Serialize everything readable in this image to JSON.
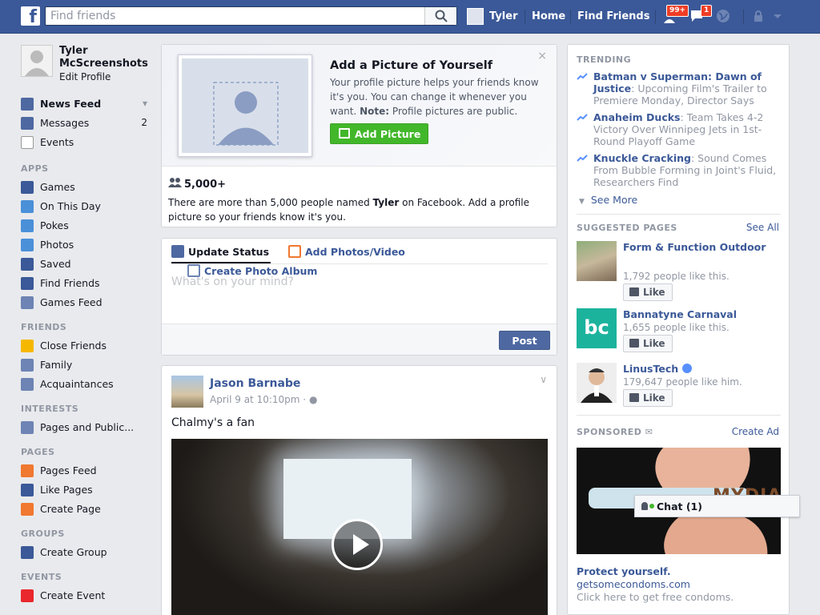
{
  "topbar": {
    "search_placeholder": "Find friends",
    "user_name": "Tyler",
    "home": "Home",
    "find_friends": "Find Friends",
    "friend_requests_badge": "99+",
    "messages_badge": "1"
  },
  "profile": {
    "name": "Tyler McScreenshots",
    "edit": "Edit Profile"
  },
  "nav": {
    "favorites": [
      {
        "label": "News Feed",
        "icon": "news-feed-icon",
        "color": "#4e69a2"
      },
      {
        "label": "Messages",
        "icon": "messages-icon",
        "color": "#4e69a2",
        "count": "2"
      },
      {
        "label": "Events",
        "icon": "calendar-icon",
        "color": "#ffffff"
      }
    ],
    "apps_header": "APPS",
    "apps": [
      {
        "label": "Games",
        "icon": "games-icon",
        "color": "#3b5998"
      },
      {
        "label": "On This Day",
        "icon": "clock-icon",
        "color": "#4a90d9"
      },
      {
        "label": "Pokes",
        "icon": "pokes-icon",
        "color": "#4a90d9"
      },
      {
        "label": "Photos",
        "icon": "photos-icon",
        "color": "#4a90d9"
      },
      {
        "label": "Saved",
        "icon": "bookmark-icon",
        "color": "#3b5998"
      },
      {
        "label": "Find Friends",
        "icon": "find-friends-icon",
        "color": "#3b5998"
      },
      {
        "label": "Games Feed",
        "icon": "gamepad-icon",
        "color": "#6d84b4"
      }
    ],
    "friends_header": "FRIENDS",
    "friends": [
      {
        "label": "Close Friends",
        "icon": "star-icon",
        "color": "#f5b800"
      },
      {
        "label": "Family",
        "icon": "family-icon",
        "color": "#6d84b4"
      },
      {
        "label": "Acquaintances",
        "icon": "acquaintances-icon",
        "color": "#6d84b4"
      }
    ],
    "interests_header": "INTERESTS",
    "interests": [
      {
        "label": "Pages and Public...",
        "icon": "list-icon",
        "color": "#6d84b4"
      }
    ],
    "pages_header": "PAGES",
    "pages": [
      {
        "label": "Pages Feed",
        "icon": "flag-icon",
        "color": "#f07830"
      },
      {
        "label": "Like Pages",
        "icon": "thumbs-up-icon",
        "color": "#3b5998"
      },
      {
        "label": "Create Page",
        "icon": "plus-icon",
        "color": "#f07830"
      }
    ],
    "groups_header": "GROUPS",
    "groups": [
      {
        "label": "Create Group",
        "icon": "plus-icon",
        "color": "#3b5998"
      }
    ],
    "events_header": "EVENTS",
    "events": [
      {
        "label": "Create Event",
        "icon": "plus-icon",
        "color": "#e9272d"
      }
    ]
  },
  "add_picture": {
    "title": "Add a Picture of Yourself",
    "desc_main": "Your profile picture helps your friends know it's you. You can change it whenever you want.",
    "note_label": "Note:",
    "note_text": "Profile pictures are public.",
    "button": "Add Picture",
    "close": "×",
    "count": "5,000+",
    "name_desc_pre": "There are more than 5,000 people named",
    "name_desc_name": "Tyler",
    "name_desc_post": "on Facebook. Add a profile picture so your friends know it's you."
  },
  "composer": {
    "tab_status": "Update Status",
    "tab_photos": "Add Photos/Video",
    "tab_album": "Create Photo Album",
    "placeholder": "What's on your mind?",
    "post": "Post"
  },
  "post": {
    "author": "Jason Barnabe",
    "time": "April 9 at 10:10pm",
    "separator": "·",
    "text": "Chalmy's a fan"
  },
  "right": {
    "trending_header": "TRENDING",
    "trending": [
      {
        "title": "Batman v Superman: Dawn of Justice",
        "desc": ": Upcoming Film's Trailer to Premiere Monday, Director Says"
      },
      {
        "title": "Anaheim Ducks",
        "desc": ": Team Takes 4-2 Victory Over Winnipeg Jets in 1st-Round Playoff Game"
      },
      {
        "title": "Knuckle Cracking",
        "desc": ": Sound Comes From Bubble Forming in Joint's Fluid, Researchers Find"
      }
    ],
    "see_more": "See More",
    "suggested_header": "SUGGESTED PAGES",
    "see_all": "See All",
    "suggested": [
      {
        "name": "Form & Function Outdoor",
        "likes": "1,792 people like this.",
        "like": "Like"
      },
      {
        "name": "Bannatyne Carnaval",
        "likes": "1,655 people like this.",
        "like": "Like"
      },
      {
        "name": "LinusTech",
        "likes": "179,647 people like him.",
        "like": "Like"
      }
    ],
    "bc_logo_text": "bc",
    "sponsored_header": "SPONSORED",
    "create_ad": "Create Ad",
    "ad": {
      "brand": "MYDIA",
      "title": "Protect yourself.",
      "url": "getsomecondoms.com",
      "desc": "Click here to get free condoms."
    }
  },
  "chat": {
    "label": "Chat (1)"
  }
}
